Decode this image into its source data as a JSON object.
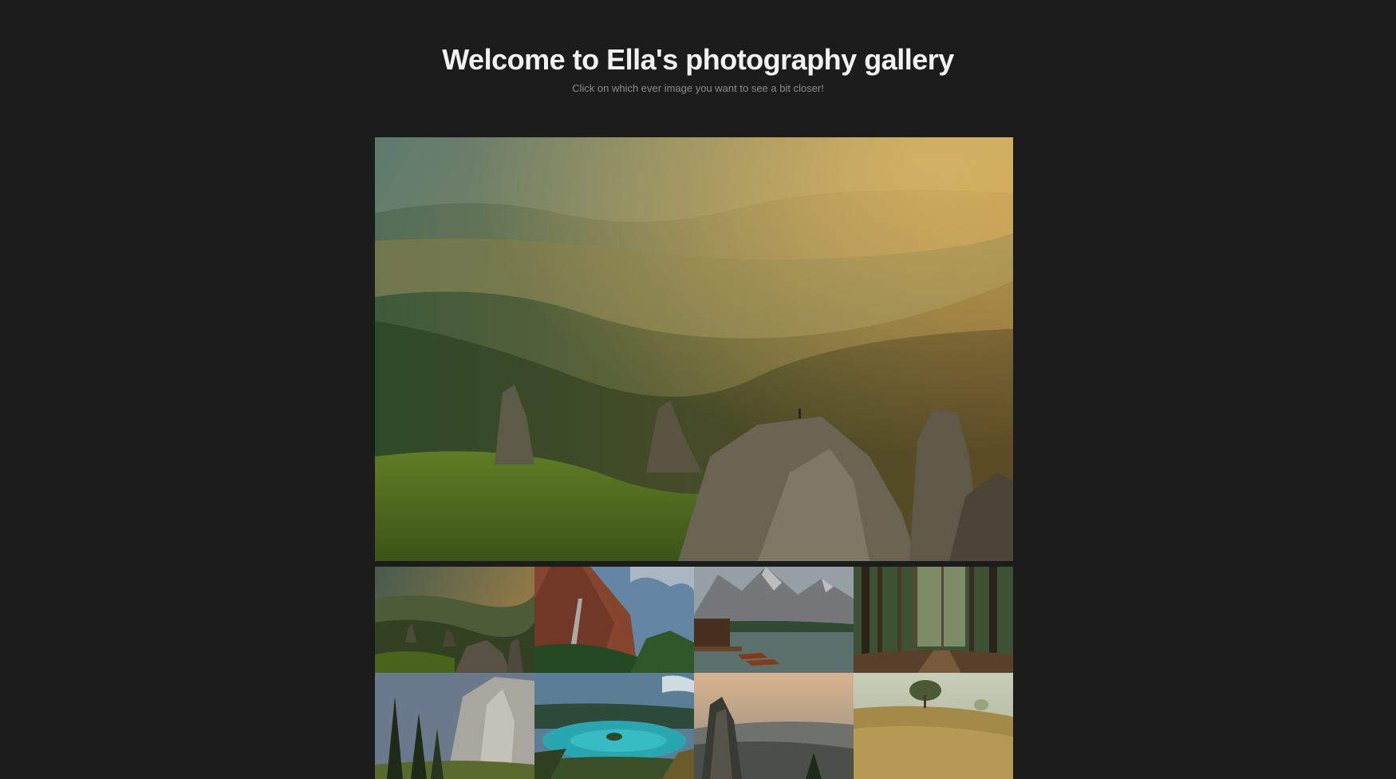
{
  "header": {
    "title": "Welcome to Ella's photography gallery",
    "subtitle": "Click on which ever image you want to see a bit closer!"
  },
  "featured": {
    "subject": "mountain-valley-sunrise-photo"
  },
  "thumbnails": [
    {
      "subject": "mountain-valley-sunrise-photo"
    },
    {
      "subject": "canyon-waterfall-photo"
    },
    {
      "subject": "alpine-lake-boathouse-photo"
    },
    {
      "subject": "pine-forest-path-photo"
    },
    {
      "subject": "granite-cliff-pines-photo"
    },
    {
      "subject": "turquoise-lake-island-photo"
    },
    {
      "subject": "rock-spire-sunset-photo"
    },
    {
      "subject": "lone-tree-meadow-photo"
    }
  ],
  "colors": {
    "background": "#1c1c1c",
    "title": "#f2f2f2",
    "subtitle": "#8a8a8a"
  }
}
